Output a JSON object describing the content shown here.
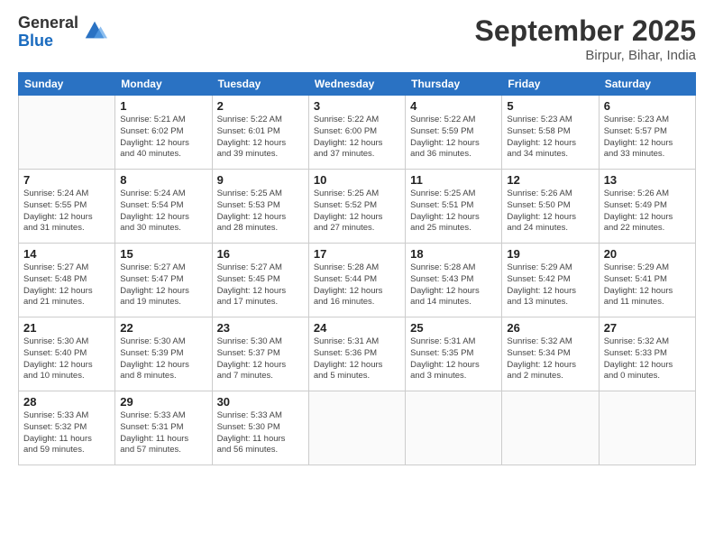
{
  "logo": {
    "general": "General",
    "blue": "Blue"
  },
  "header": {
    "month": "September 2025",
    "location": "Birpur, Bihar, India"
  },
  "weekdays": [
    "Sunday",
    "Monday",
    "Tuesday",
    "Wednesday",
    "Thursday",
    "Friday",
    "Saturday"
  ],
  "weeks": [
    [
      {
        "day": "",
        "info": ""
      },
      {
        "day": "1",
        "info": "Sunrise: 5:21 AM\nSunset: 6:02 PM\nDaylight: 12 hours\nand 40 minutes."
      },
      {
        "day": "2",
        "info": "Sunrise: 5:22 AM\nSunset: 6:01 PM\nDaylight: 12 hours\nand 39 minutes."
      },
      {
        "day": "3",
        "info": "Sunrise: 5:22 AM\nSunset: 6:00 PM\nDaylight: 12 hours\nand 37 minutes."
      },
      {
        "day": "4",
        "info": "Sunrise: 5:22 AM\nSunset: 5:59 PM\nDaylight: 12 hours\nand 36 minutes."
      },
      {
        "day": "5",
        "info": "Sunrise: 5:23 AM\nSunset: 5:58 PM\nDaylight: 12 hours\nand 34 minutes."
      },
      {
        "day": "6",
        "info": "Sunrise: 5:23 AM\nSunset: 5:57 PM\nDaylight: 12 hours\nand 33 minutes."
      }
    ],
    [
      {
        "day": "7",
        "info": "Sunrise: 5:24 AM\nSunset: 5:55 PM\nDaylight: 12 hours\nand 31 minutes."
      },
      {
        "day": "8",
        "info": "Sunrise: 5:24 AM\nSunset: 5:54 PM\nDaylight: 12 hours\nand 30 minutes."
      },
      {
        "day": "9",
        "info": "Sunrise: 5:25 AM\nSunset: 5:53 PM\nDaylight: 12 hours\nand 28 minutes."
      },
      {
        "day": "10",
        "info": "Sunrise: 5:25 AM\nSunset: 5:52 PM\nDaylight: 12 hours\nand 27 minutes."
      },
      {
        "day": "11",
        "info": "Sunrise: 5:25 AM\nSunset: 5:51 PM\nDaylight: 12 hours\nand 25 minutes."
      },
      {
        "day": "12",
        "info": "Sunrise: 5:26 AM\nSunset: 5:50 PM\nDaylight: 12 hours\nand 24 minutes."
      },
      {
        "day": "13",
        "info": "Sunrise: 5:26 AM\nSunset: 5:49 PM\nDaylight: 12 hours\nand 22 minutes."
      }
    ],
    [
      {
        "day": "14",
        "info": "Sunrise: 5:27 AM\nSunset: 5:48 PM\nDaylight: 12 hours\nand 21 minutes."
      },
      {
        "day": "15",
        "info": "Sunrise: 5:27 AM\nSunset: 5:47 PM\nDaylight: 12 hours\nand 19 minutes."
      },
      {
        "day": "16",
        "info": "Sunrise: 5:27 AM\nSunset: 5:45 PM\nDaylight: 12 hours\nand 17 minutes."
      },
      {
        "day": "17",
        "info": "Sunrise: 5:28 AM\nSunset: 5:44 PM\nDaylight: 12 hours\nand 16 minutes."
      },
      {
        "day": "18",
        "info": "Sunrise: 5:28 AM\nSunset: 5:43 PM\nDaylight: 12 hours\nand 14 minutes."
      },
      {
        "day": "19",
        "info": "Sunrise: 5:29 AM\nSunset: 5:42 PM\nDaylight: 12 hours\nand 13 minutes."
      },
      {
        "day": "20",
        "info": "Sunrise: 5:29 AM\nSunset: 5:41 PM\nDaylight: 12 hours\nand 11 minutes."
      }
    ],
    [
      {
        "day": "21",
        "info": "Sunrise: 5:30 AM\nSunset: 5:40 PM\nDaylight: 12 hours\nand 10 minutes."
      },
      {
        "day": "22",
        "info": "Sunrise: 5:30 AM\nSunset: 5:39 PM\nDaylight: 12 hours\nand 8 minutes."
      },
      {
        "day": "23",
        "info": "Sunrise: 5:30 AM\nSunset: 5:37 PM\nDaylight: 12 hours\nand 7 minutes."
      },
      {
        "day": "24",
        "info": "Sunrise: 5:31 AM\nSunset: 5:36 PM\nDaylight: 12 hours\nand 5 minutes."
      },
      {
        "day": "25",
        "info": "Sunrise: 5:31 AM\nSunset: 5:35 PM\nDaylight: 12 hours\nand 3 minutes."
      },
      {
        "day": "26",
        "info": "Sunrise: 5:32 AM\nSunset: 5:34 PM\nDaylight: 12 hours\nand 2 minutes."
      },
      {
        "day": "27",
        "info": "Sunrise: 5:32 AM\nSunset: 5:33 PM\nDaylight: 12 hours\nand 0 minutes."
      }
    ],
    [
      {
        "day": "28",
        "info": "Sunrise: 5:33 AM\nSunset: 5:32 PM\nDaylight: 11 hours\nand 59 minutes."
      },
      {
        "day": "29",
        "info": "Sunrise: 5:33 AM\nSunset: 5:31 PM\nDaylight: 11 hours\nand 57 minutes."
      },
      {
        "day": "30",
        "info": "Sunrise: 5:33 AM\nSunset: 5:30 PM\nDaylight: 11 hours\nand 56 minutes."
      },
      {
        "day": "",
        "info": ""
      },
      {
        "day": "",
        "info": ""
      },
      {
        "day": "",
        "info": ""
      },
      {
        "day": "",
        "info": ""
      }
    ]
  ]
}
